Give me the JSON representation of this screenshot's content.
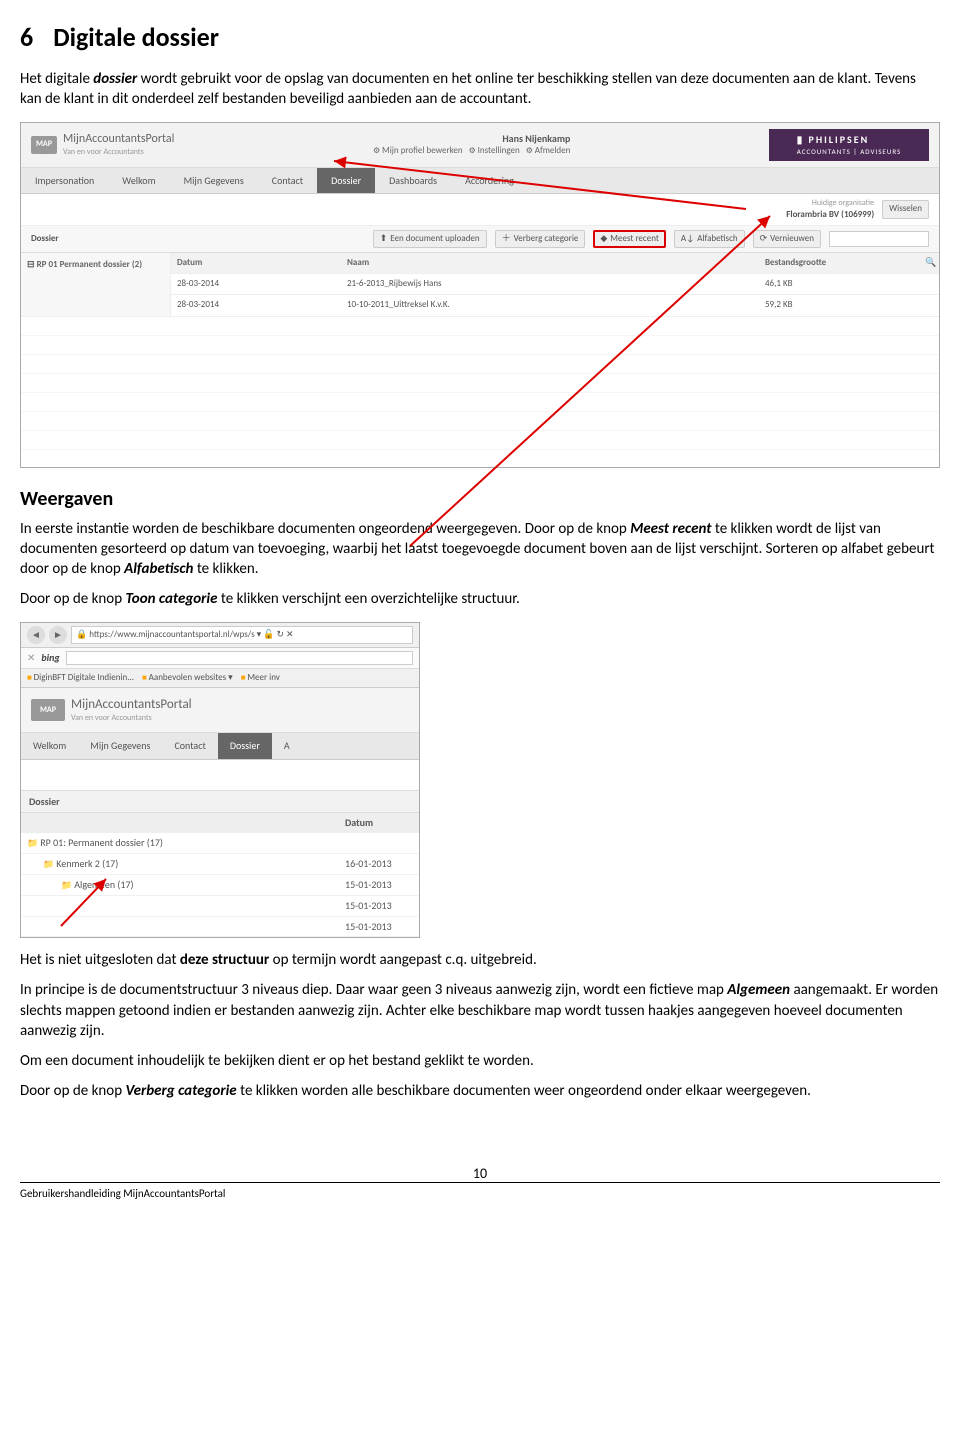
{
  "section": {
    "number": "6",
    "title": "Digitale dossier"
  },
  "intro": {
    "p1a": "Het digitale ",
    "p1b": "dossier",
    "p1c": " wordt gebruikt voor de opslag van documenten en het online ter beschikking stellen van deze documenten aan de klant. Tevens kan de klant in dit onderdeel zelf bestanden beveiligd aanbieden aan de accountant."
  },
  "shot1": {
    "brand_logo": "MAP",
    "brand_title": "MijnAccountantsPortal",
    "brand_sub": "Van en voor Accountants",
    "partner": "PHILIPSEN",
    "partner_sub": "ACCOUNTANTS | ADVISEURS",
    "user_name": "Hans Nijenkamp",
    "user_links": [
      "Mijn profiel bewerken",
      "Instellingen",
      "Afmelden"
    ],
    "tabs": [
      "Impersonation",
      "Welkom",
      "Mijn Gegevens",
      "Contact",
      "Dossier",
      "Dashboards",
      "Accordering"
    ],
    "tab_active_index": 4,
    "org_label": "Huidige organisatie",
    "org_name": "Florambria BV (106999)",
    "org_btn": "Wisselen",
    "toolbar_title": "Dossier",
    "toolbar_buttons": [
      "Een document uploaden",
      "Verberg categorie",
      "Meest recent",
      "Alfabetisch",
      "Vernieuwen"
    ],
    "toolbar_hl_index": 2,
    "side_caption": "RP 01 Permanent dossier (2)",
    "cols": [
      "Datum",
      "Naam",
      "Bestandsgrootte"
    ],
    "rows": [
      {
        "datum": "28-03-2014",
        "naam": "21-6-2013_Rijbewijs Hans",
        "size": "46,1 KB"
      },
      {
        "datum": "28-03-2014",
        "naam": "10-10-2011_Uittreksel K.v.K.",
        "size": "59,2 KB"
      }
    ]
  },
  "weergaven": {
    "title": "Weergaven",
    "p1a": "In eerste instantie worden de beschikbare documenten ongeordend weergegeven. Door op de knop ",
    "p1b": "Meest recent",
    "p1c": " te klikken wordt de lijst van documenten gesorteerd op datum van toevoeging, waarbij het laatst toegevoegde document boven aan de lijst verschijnt. Sorteren op alfabet gebeurt door op de knop ",
    "p1d": "Alfabetisch",
    "p1e": " te klikken.",
    "p2a": "Door op de knop ",
    "p2b": "Toon categorie",
    "p2c": " te klikken verschijnt een overzichtelijke structuur."
  },
  "shot2": {
    "url": "https://www.mijnaccountantsportal.nl/wps/s",
    "bing": "bing",
    "fav": [
      "DiginBFT Digitale Indienin...",
      "Aanbevolen websites ▾",
      "Meer inv"
    ],
    "brand_logo": "MAP",
    "brand_title": "MijnAccountantsPortal",
    "brand_sub": "Van en voor Accountants",
    "tabs": [
      "Welkom",
      "Mijn Gegevens",
      "Contact",
      "Dossier",
      "A"
    ],
    "tab_active_index": 3,
    "panel_title": "Dossier",
    "col_date": "Datum",
    "tree": [
      {
        "lvl": 0,
        "label": "RP 01: Permanent dossier (17)",
        "exp": true,
        "date": ""
      },
      {
        "lvl": 1,
        "label": "Kenmerk 2 (17)",
        "exp": true,
        "date": "16-01-2013"
      },
      {
        "lvl": 2,
        "label": "Algemeen (17)",
        "exp": false,
        "date": "15-01-2013"
      },
      {
        "lvl": 2,
        "label": "",
        "exp": false,
        "date": "15-01-2013"
      },
      {
        "lvl": 2,
        "label": "",
        "exp": false,
        "date": "15-01-2013"
      }
    ]
  },
  "tail": {
    "p1a": "Het is niet uitgesloten dat ",
    "p1b": "deze structuur",
    "p1c": " op termijn wordt aangepast c.q. uitgebreid.",
    "p2a": "In principe is de documentstructuur 3 niveaus diep. Daar waar geen 3 niveaus aanwezig zijn, wordt een fictieve map ",
    "p2b": "Algemeen",
    "p2c": " aangemaakt. Er worden slechts mappen getoond indien er bestanden aanwezig zijn. Achter elke beschikbare map wordt tussen haakjes aangegeven hoeveel documenten aanwezig zijn.",
    "p3": "Om een document inhoudelijk te bekijken dient er op het bestand geklikt te worden.",
    "p4a": "Door op de knop ",
    "p4b": "Verberg categorie",
    "p4c": " te klikken worden alle beschikbare documenten weer ongeordend onder elkaar weergegeven."
  },
  "footer": {
    "page": "10",
    "title": "Gebruikershandleiding MijnAccountantsPortal"
  }
}
